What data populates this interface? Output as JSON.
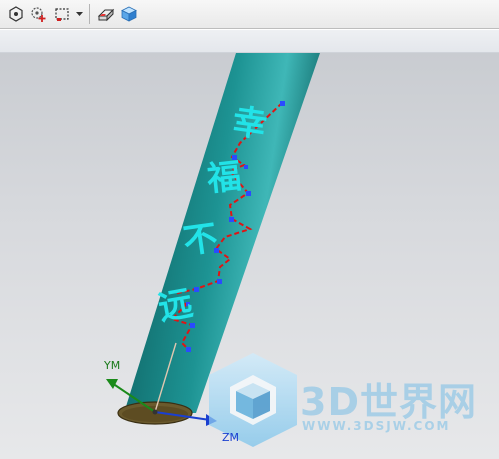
{
  "toolbar": {
    "buttons": [
      {
        "icon": "hexagon-dot-icon"
      },
      {
        "icon": "gear-plus-icon"
      },
      {
        "icon": "dashed-rectangle-icon"
      },
      {
        "icon": "eraser-icon"
      },
      {
        "icon": "cube-icon"
      }
    ]
  },
  "viewport": {
    "engraved_text": "幸福不远",
    "axes": {
      "ym": "YM",
      "zm": "ZM"
    }
  },
  "watermark": {
    "brand": "3D世界网",
    "url": "WWW.3DSJW.COM"
  },
  "colors": {
    "cylinder": "#1a8a8a",
    "text": "#22e3e8",
    "path": "#e01414",
    "ym_axis": "#1a8a1a",
    "zm_axis": "#1a3fd0"
  }
}
